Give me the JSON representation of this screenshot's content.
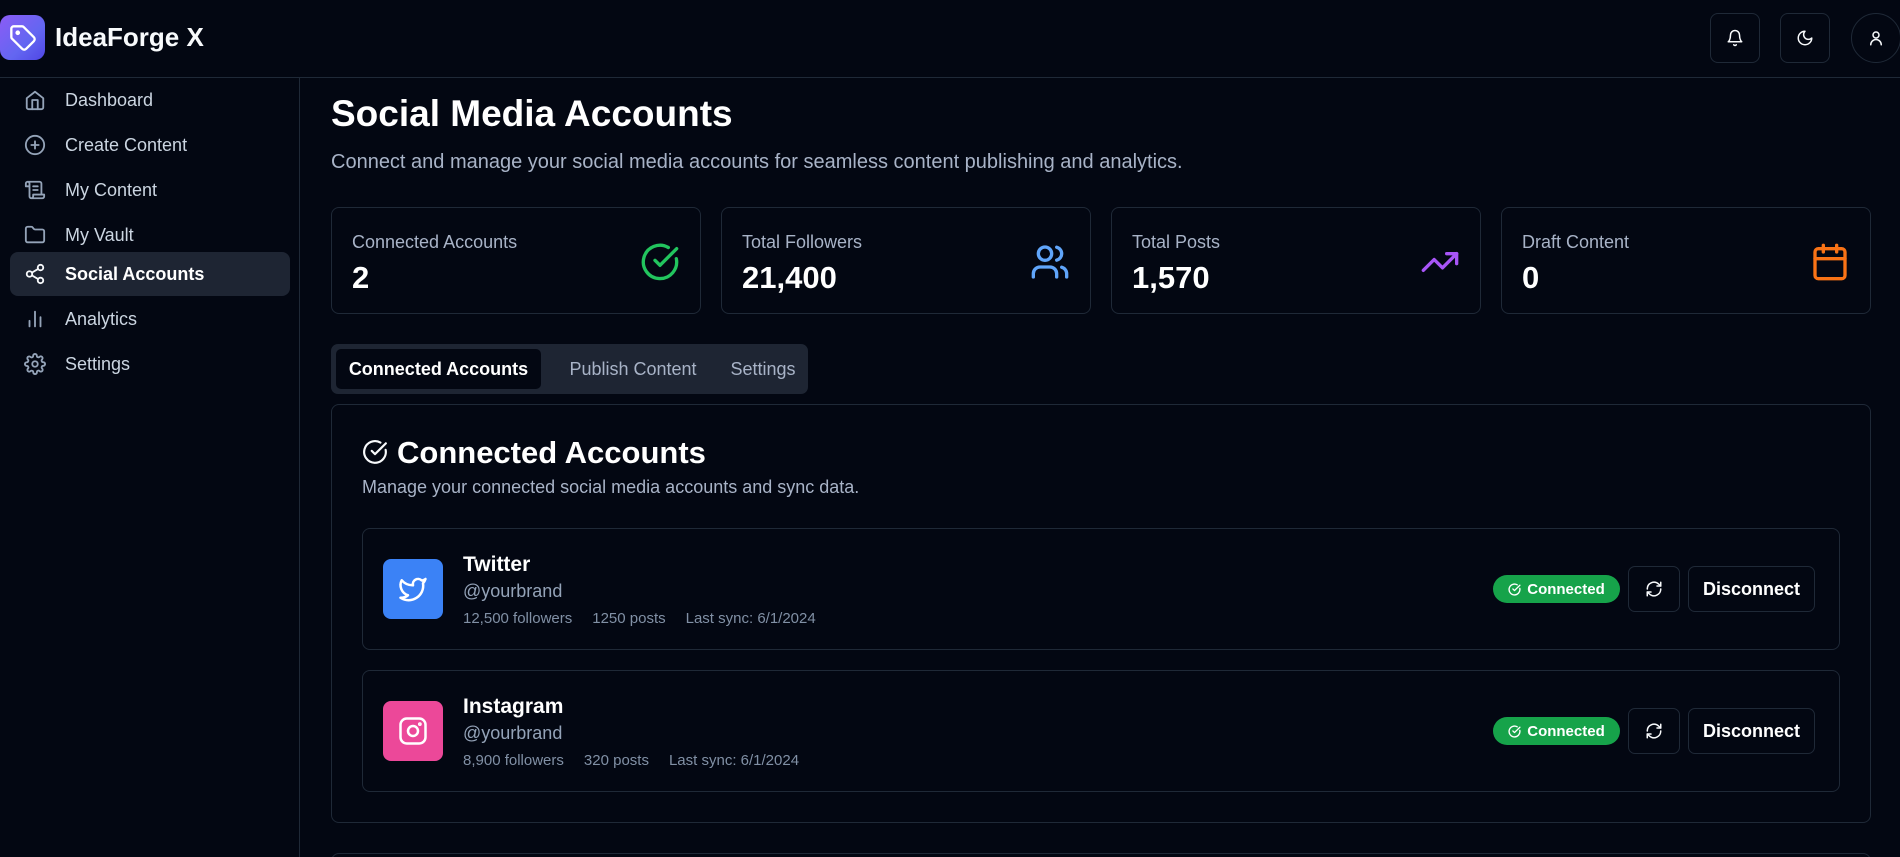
{
  "app": {
    "name": "IdeaForge X"
  },
  "header": {
    "notifications_icon": "bell-icon",
    "theme_icon": "moon-icon",
    "profile_icon": "user-icon"
  },
  "sidebar": {
    "items": [
      {
        "label": "Dashboard",
        "icon": "home-icon",
        "active": false
      },
      {
        "label": "Create Content",
        "icon": "plus-circle-icon",
        "active": false
      },
      {
        "label": "My Content",
        "icon": "scroll-icon",
        "active": false
      },
      {
        "label": "My Vault",
        "icon": "folder-icon",
        "active": false
      },
      {
        "label": "Social Accounts",
        "icon": "share-icon",
        "active": true
      },
      {
        "label": "Analytics",
        "icon": "bar-chart-icon",
        "active": false
      },
      {
        "label": "Settings",
        "icon": "gear-icon",
        "active": false
      }
    ]
  },
  "page": {
    "title": "Social Media Accounts",
    "subtitle": "Connect and manage your social media accounts for seamless content publishing and analytics."
  },
  "stats": [
    {
      "label": "Connected Accounts",
      "value": "2",
      "icon": "check-circle-icon",
      "color": "#22c55e"
    },
    {
      "label": "Total Followers",
      "value": "21,400",
      "icon": "users-icon",
      "color": "#60a5fa"
    },
    {
      "label": "Total Posts",
      "value": "1,570",
      "icon": "trending-up-icon",
      "color": "#a855f7"
    },
    {
      "label": "Draft Content",
      "value": "0",
      "icon": "calendar-icon",
      "color": "#f97316"
    }
  ],
  "tabs": [
    {
      "label": "Connected Accounts",
      "active": true
    },
    {
      "label": "Publish Content",
      "active": false
    },
    {
      "label": "Settings",
      "active": false
    }
  ],
  "connected": {
    "title": "Connected Accounts",
    "subtitle": "Manage your connected social media accounts and sync data.",
    "accounts": [
      {
        "name": "Twitter",
        "handle": "@yourbrand",
        "followers": "12,500 followers",
        "posts": "1250 posts",
        "last_sync": "Last sync: 6/1/2024",
        "status": "Connected",
        "action": "Disconnect",
        "icon": "twitter-icon",
        "color": "#3b82f6"
      },
      {
        "name": "Instagram",
        "handle": "@yourbrand",
        "followers": "8,900 followers",
        "posts": "320 posts",
        "last_sync": "Last sync: 6/1/2024",
        "status": "Connected",
        "action": "Disconnect",
        "icon": "instagram-icon",
        "color": "#ec4899"
      }
    ]
  }
}
